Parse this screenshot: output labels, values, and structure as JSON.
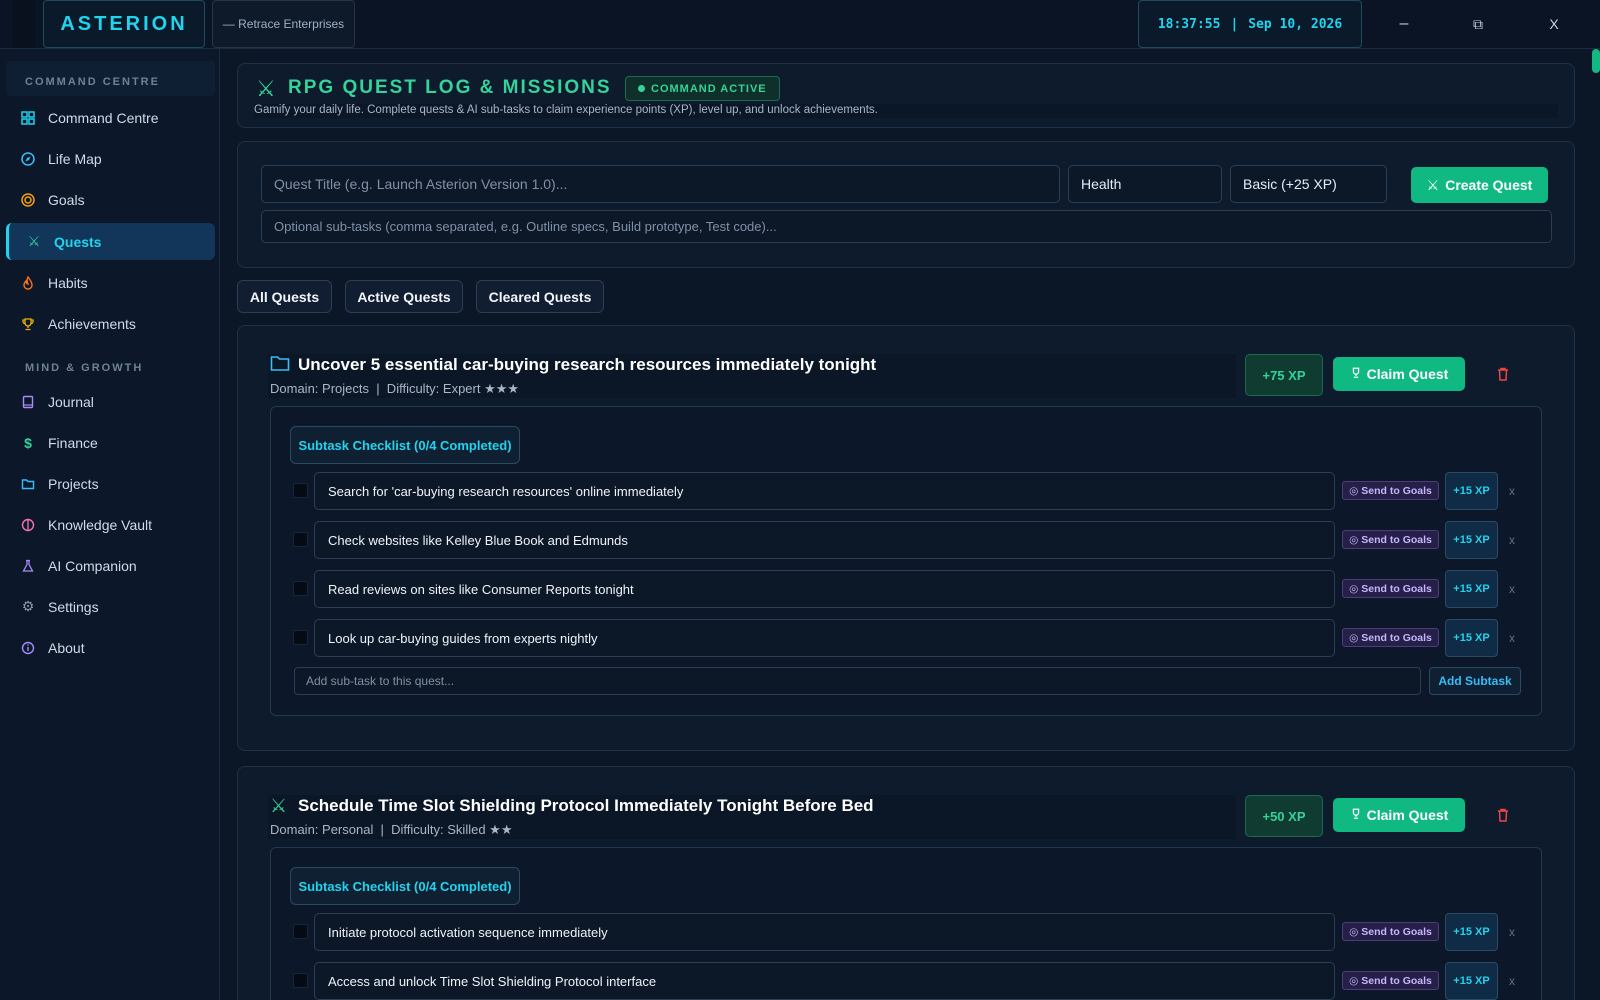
{
  "app": {
    "brand": "ASTERION",
    "company": "— Retrace Enterprises"
  },
  "clock": {
    "time": "18:37:55",
    "separator": "|",
    "date": "Sep 10, 2026"
  },
  "window_controls": {
    "minimize": "–",
    "restore": "⧉",
    "close": "X"
  },
  "sidebar": {
    "section1": "COMMAND CENTRE",
    "section2": "MIND & GROWTH",
    "items": [
      {
        "label": "Command Centre",
        "icon": "grid-icon"
      },
      {
        "label": "Life Map",
        "icon": "compass-icon"
      },
      {
        "label": "Goals",
        "icon": "target-icon"
      },
      {
        "label": "Quests",
        "icon": "swords-icon"
      },
      {
        "label": "Habits",
        "icon": "flame-icon"
      },
      {
        "label": "Achievements",
        "icon": "trophy-icon"
      },
      {
        "label": "Journal",
        "icon": "book-icon"
      },
      {
        "label": "Finance",
        "icon": "dollar-icon"
      },
      {
        "label": "Projects",
        "icon": "folder-icon"
      },
      {
        "label": "Knowledge Vault",
        "icon": "brain-icon"
      },
      {
        "label": "AI Companion",
        "icon": "flask-icon"
      },
      {
        "label": "Settings",
        "icon": "gear-icon"
      },
      {
        "label": "About",
        "icon": "info-icon"
      }
    ]
  },
  "header": {
    "icon": "⚔",
    "title": "RPG QUEST LOG & MISSIONS",
    "badge": "COMMAND ACTIVE",
    "subtitle": "Gamify your daily life. Complete quests & AI sub-tasks to claim experience points (XP), level up, and unlock achievements."
  },
  "form": {
    "title_placeholder": "Quest Title (e.g. Launch Asterion Version 1.0)...",
    "domain_value": "Health",
    "difficulty_value": "Basic (+25 XP)",
    "create_label": "Create Quest",
    "subtasks_placeholder": "Optional sub-tasks (comma separated, e.g. Outline specs, Build prototype, Test code)..."
  },
  "filters": [
    "All Quests",
    "Active Quests",
    "Cleared Quests"
  ],
  "quests": [
    {
      "icon": "🗀",
      "title": "Uncover 5 essential car-buying research resources immediately tonight",
      "meta": "Domain: Projects  |  Difficulty: Expert ★★★",
      "xp": "+75 XP",
      "claim": "Claim Quest",
      "checklist": "Subtask Checklist (0/4 Completed)",
      "subtasks": [
        {
          "text": "Search for 'car-buying research resources' online immediately",
          "send": "Send to Goals",
          "xp": "+15 XP",
          "remove": "x"
        },
        {
          "text": "Check websites like Kelley Blue Book and Edmunds",
          "send": "Send to Goals",
          "xp": "+15 XP",
          "remove": "x"
        },
        {
          "text": "Read reviews on sites like Consumer Reports tonight",
          "send": "Send to Goals",
          "xp": "+15 XP",
          "remove": "x"
        },
        {
          "text": "Look up car-buying guides from experts nightly",
          "send": "Send to Goals",
          "xp": "+15 XP",
          "remove": "x"
        }
      ],
      "add_placeholder": "Add sub-task to this quest...",
      "add_label": "Add Subtask"
    },
    {
      "icon": "⚔",
      "title": "Schedule Time Slot Shielding Protocol Immediately Tonight Before Bed",
      "meta": "Domain: Personal  |  Difficulty: Skilled ★★",
      "xp": "+50 XP",
      "claim": "Claim Quest",
      "checklist": "Subtask Checklist (0/4 Completed)",
      "subtasks": [
        {
          "text": "Initiate protocol activation sequence immediately",
          "send": "Send to Goals",
          "xp": "+15 XP",
          "remove": "x"
        },
        {
          "text": "Access and unlock Time Slot Shielding Protocol interface",
          "send": "Send to Goals",
          "xp": "+15 XP",
          "remove": "x"
        }
      ]
    }
  ],
  "colors": {
    "accent": "#22d3ee",
    "success": "#10b981",
    "violet": "#c4b5fd",
    "danger": "#ef4444"
  }
}
